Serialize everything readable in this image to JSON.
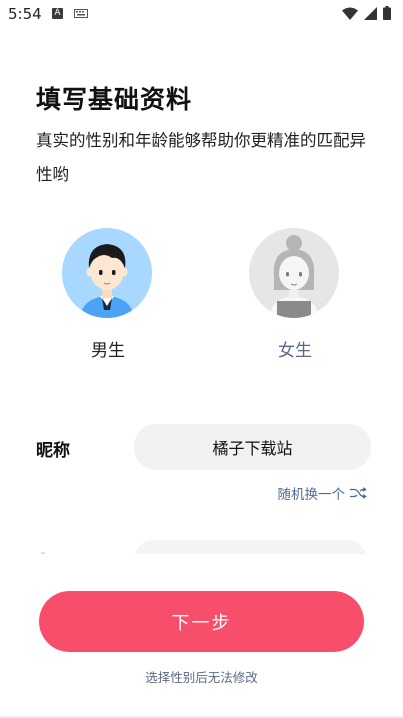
{
  "status_bar": {
    "time": "5:54",
    "app_icon_letter": "A",
    "icons": [
      "wifi-icon",
      "signal-icon",
      "battery-icon"
    ]
  },
  "header": {
    "title": "填写基础资料",
    "subtitle": "真实的性别和年龄能够帮助你更精准的匹配异性哟"
  },
  "gender": {
    "male_label": "男生",
    "female_label": "女生",
    "selected": "male"
  },
  "nickname": {
    "label": "昵称",
    "value": "橘子下载站",
    "random_label": "随机换一个"
  },
  "actions": {
    "next_label": "下一步",
    "footnote": "选择性别后无法修改"
  },
  "colors": {
    "accent": "#f74f6b",
    "link": "#4d6a95",
    "male_bg": "#a8d8ff",
    "female_bg": "#e6e6e6"
  }
}
